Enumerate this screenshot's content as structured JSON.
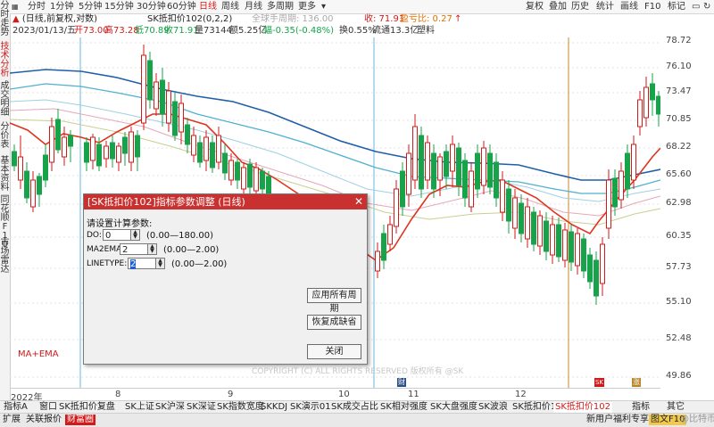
{
  "left_tabs": [
    "分时走势",
    "技术分析",
    "成交明细",
    "分价表",
    "基本资料",
    "同花顺F10",
    "市场雷达"
  ],
  "toolbar": {
    "periods": [
      "分时",
      "1分钟",
      "5分钟",
      "15分钟",
      "30分钟",
      "60分钟",
      "日线",
      "周线",
      "月线",
      "多周期",
      "更多"
    ],
    "active_period": "日线",
    "title": "(日线,前复权,对数)",
    "indicator": "SK抵扣价102(0,2,2)",
    "hold_label": "全球手周期: 136.00",
    "cost_label": "收: 71.91",
    "profit_label": "盈亏比: 0.27",
    "right_buttons": [
      "复权",
      "叠加",
      "历史",
      "统计",
      "画线",
      "F10",
      "标记"
    ],
    "icons": [
      "monitor-icon",
      "refresh-icon"
    ]
  },
  "quote": {
    "date": "2023/01/13/五",
    "open": "开73.00",
    "high": "高73.28",
    "low": "低70.89",
    "close": "收71.91",
    "volume": "量73144",
    "amount": "额5.25亿",
    "change": "幅-0.35(-0.48%)",
    "turnover": "换0.55%",
    "float_cap": "流通13.3亿",
    "sector": "塑料"
  },
  "y_axis": [
    "78.72",
    "76.10",
    "73.47",
    "70.85",
    "68.22",
    "65.60",
    "62.98",
    "60.35",
    "57.73",
    "55.10",
    "52.48",
    "49.86"
  ],
  "x_axis": {
    "year": "2022年",
    "months": [
      "8",
      "9",
      "10",
      "11",
      "12"
    ]
  },
  "chart_labels": {
    "indicator_name": "MA+EMA",
    "watermark": "COPYRIGHT (C) ALL RIGHTS RESERVED 版权所有 @SK"
  },
  "markers": [
    "财",
    "SK",
    "涨"
  ],
  "dialog": {
    "title": "[SK抵扣价102]指标参数调整 (日线)",
    "prompt": "请设置计算参数:",
    "params": [
      {
        "name": "DO:",
        "value": "0",
        "range": "(0.00—180.00)"
      },
      {
        "name": "MA2EMA:",
        "value": "2",
        "range": "(0.00—2.00)"
      },
      {
        "name": "LINETYPE:",
        "value": "2",
        "range": "(0.00—2.00)"
      }
    ],
    "buttons": [
      "应用所有周期",
      "恢复成缺省",
      "关闭"
    ]
  },
  "bottom_tabs_1": [
    "指标A",
    "窗口",
    "SK抵扣价复盘",
    "SK上证",
    "SK沪深",
    "SK深证",
    "SK指数宽度",
    "SKKDJ",
    "SK演示01",
    "SK成交占比",
    "SK相对强度",
    "SK大盘强度",
    "SK波浪",
    "SK抵扣价1",
    "SK抵扣价102",
    "指标",
    "其它"
  ],
  "bottom_tabs_2": [
    "扩展",
    "关联报价",
    "财富圈"
  ],
  "bottom_right": {
    "promo": "新用户福利专享",
    "language": "图文F10",
    "brand": "@比特币"
  },
  "colors": {
    "up": "#d21a1a",
    "down": "#16a34a",
    "ma_red": "#e0341f",
    "ma_blue": "#1f5fa8",
    "ma_cyan": "#4fb0cf",
    "ma_light": "#9ed0e2",
    "ma_pink": "#e8a6b8",
    "ma_olive": "#c9cf90"
  }
}
